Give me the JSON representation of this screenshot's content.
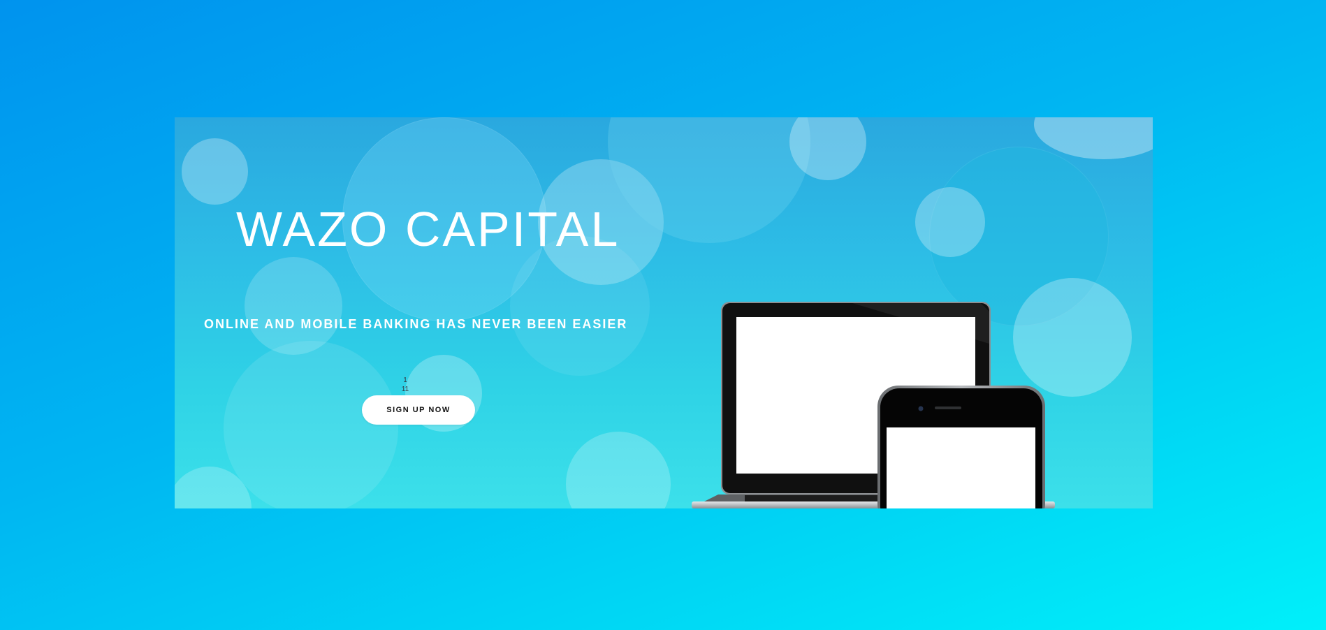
{
  "hero": {
    "title": "WAZO CAPITAL",
    "subtitle": "ONLINE AND MOBILE BANKING HAS NEVER BEEN EASIER",
    "slide_counter_top": "1",
    "slide_counter_bottom": "11",
    "cta_label": "SIGN UP NOW",
    "devices": [
      "laptop-mockup",
      "smartphone-mockup"
    ]
  },
  "colors": {
    "page_gradient_start": "#0093ee",
    "page_gradient_end": "#00f0fa",
    "hero_bokeh": "#2fc6e6",
    "text": "#ffffff",
    "button_bg": "#ffffff",
    "button_text": "#111111"
  }
}
